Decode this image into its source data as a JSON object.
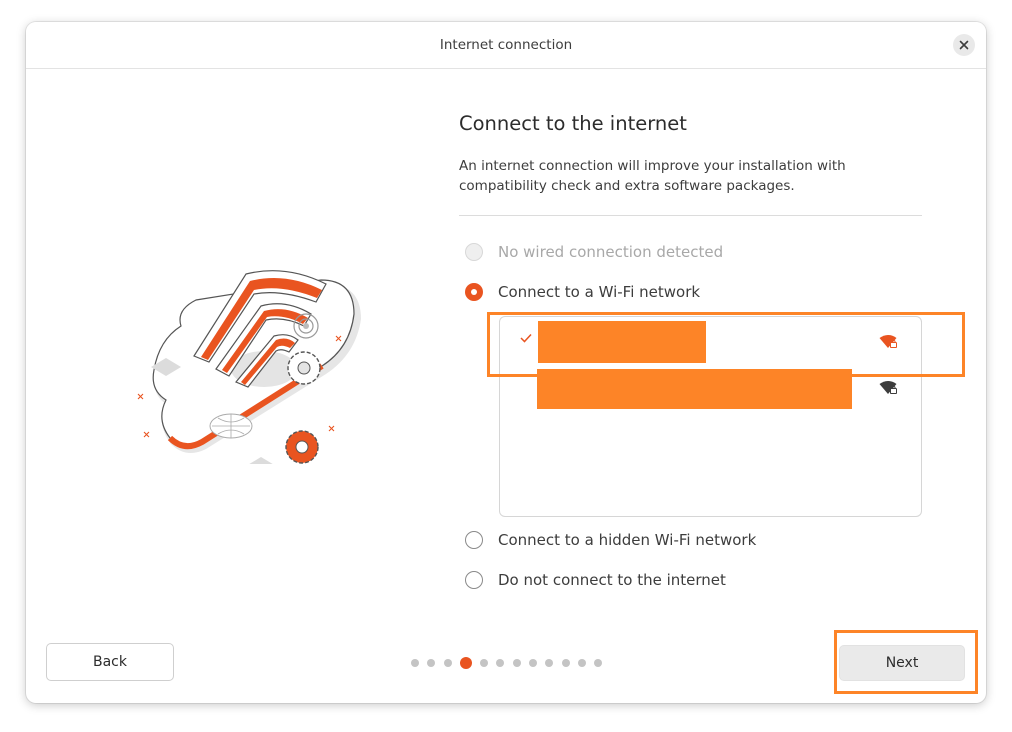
{
  "window": {
    "title": "Internet connection"
  },
  "page": {
    "heading": "Connect to the internet",
    "description": "An internet connection will improve your installation with compatibility check and extra software packages."
  },
  "options": [
    {
      "label": "No wired connection detected",
      "state": "disabled"
    },
    {
      "label": "Connect to a Wi-Fi network",
      "state": "selected"
    },
    {
      "label": "Connect to a hidden Wi-Fi network",
      "state": "unselected"
    },
    {
      "label": "Do not connect to the internet",
      "state": "unselected"
    }
  ],
  "wifi_networks": [
    {
      "name_redacted": true,
      "connected": true,
      "secured": true,
      "signal_icon": "wifi-lock-icon",
      "signal_color": "#e95420"
    },
    {
      "name_redacted": true,
      "connected": false,
      "secured": true,
      "signal_icon": "wifi-lock-icon",
      "signal_color": "#3d3d3d"
    }
  ],
  "footer": {
    "back_label": "Back",
    "next_label": "Next",
    "step_total": 12,
    "step_current": 4
  },
  "colors": {
    "accent": "#e95420",
    "highlight": "#fd8427"
  }
}
